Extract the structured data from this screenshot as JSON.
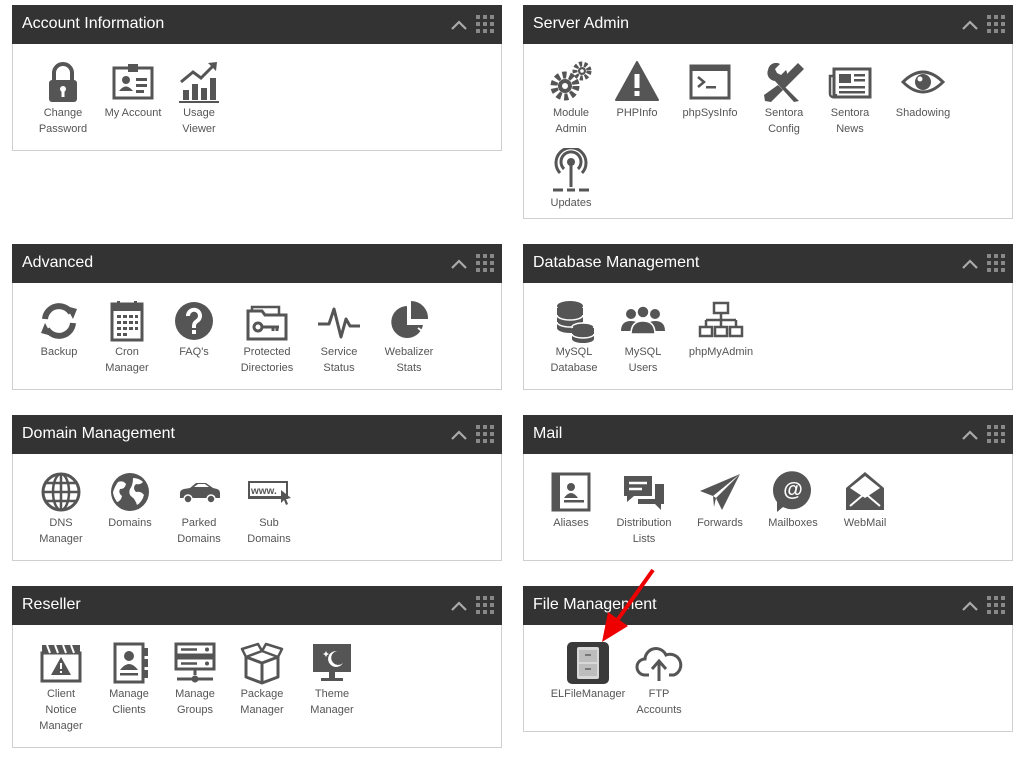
{
  "panels": {
    "account": {
      "title": "Account Information",
      "items": [
        {
          "label": "Change Password",
          "icon": "lock-icon"
        },
        {
          "label": "My Account",
          "icon": "id-card-icon"
        },
        {
          "label": "Usage Viewer",
          "icon": "usage-chart-icon"
        }
      ]
    },
    "server": {
      "title": "Server Admin",
      "items": [
        {
          "label": "Module Admin",
          "icon": "gears-icon"
        },
        {
          "label": "PHPInfo",
          "icon": "warning-icon"
        },
        {
          "label": "phpSysInfo",
          "icon": "terminal-icon"
        },
        {
          "label": "Sentora Config",
          "icon": "tools-icon"
        },
        {
          "label": "Sentora News",
          "icon": "newspaper-icon"
        },
        {
          "label": "Shadowing",
          "icon": "eye-icon"
        },
        {
          "label": "Updates",
          "icon": "broadcast-icon"
        }
      ]
    },
    "advanced": {
      "title": "Advanced",
      "items": [
        {
          "label": "Backup",
          "icon": "refresh-icon"
        },
        {
          "label": "Cron Manager",
          "icon": "calendar-icon"
        },
        {
          "label": "FAQ's",
          "icon": "question-icon"
        },
        {
          "label": "Protected Directories",
          "icon": "folder-key-icon"
        },
        {
          "label": "Service Status",
          "icon": "pulse-icon"
        },
        {
          "label": "Webalizer Stats",
          "icon": "pie-chart-icon"
        }
      ]
    },
    "database": {
      "title": "Database Management",
      "items": [
        {
          "label": "MySQL Database",
          "icon": "database-icon"
        },
        {
          "label": "MySQL Users",
          "icon": "users-icon"
        },
        {
          "label": "phpMyAdmin",
          "icon": "sitemap-icon"
        }
      ]
    },
    "domain": {
      "title": "Domain Management",
      "items": [
        {
          "label": "DNS Manager",
          "icon": "globe-grid-icon"
        },
        {
          "label": "Domains",
          "icon": "globe-icon"
        },
        {
          "label": "Parked Domains",
          "icon": "car-icon"
        },
        {
          "label": "Sub Domains",
          "icon": "www-icon"
        }
      ]
    },
    "mail": {
      "title": "Mail",
      "items": [
        {
          "label": "Aliases",
          "icon": "contact-card-icon"
        },
        {
          "label": "Distribution Lists",
          "icon": "chat-bubbles-icon"
        },
        {
          "label": "Forwards",
          "icon": "paper-plane-icon"
        },
        {
          "label": "Mailboxes",
          "icon": "at-sign-icon"
        },
        {
          "label": "WebMail",
          "icon": "envelope-open-icon"
        }
      ]
    },
    "reseller": {
      "title": "Reseller",
      "items": [
        {
          "label": "Client Notice Manager",
          "icon": "notice-board-icon"
        },
        {
          "label": "Manage Clients",
          "icon": "client-book-icon"
        },
        {
          "label": "Manage Groups",
          "icon": "server-stack-icon"
        },
        {
          "label": "Package Manager",
          "icon": "box-icon"
        },
        {
          "label": "Theme Manager",
          "icon": "monitor-moon-icon"
        }
      ]
    },
    "files": {
      "title": "File Management",
      "items": [
        {
          "label": "ELFileManager",
          "icon": "file-cabinet-icon"
        },
        {
          "label": "FTP Accounts",
          "icon": "cloud-upload-icon"
        }
      ]
    }
  },
  "colors": {
    "header_bg": "#333333",
    "header_text": "#ffffff",
    "icon": "#555555",
    "label": "#555555",
    "annotation_arrow": "#ee0000"
  }
}
